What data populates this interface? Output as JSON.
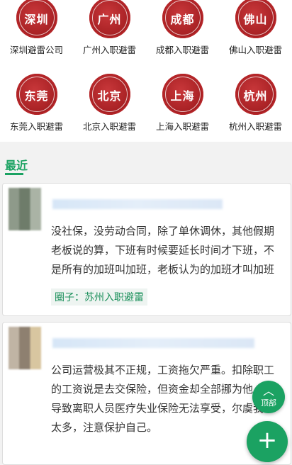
{
  "circles": [
    {
      "seal": "深圳",
      "label": "深圳避雷公司"
    },
    {
      "seal": "广州",
      "label": "广州入职避雷"
    },
    {
      "seal": "成都",
      "label": "成都入职避雷"
    },
    {
      "seal": "佛山",
      "label": "佛山入职避雷"
    },
    {
      "seal": "东莞",
      "label": "东莞入职避雷"
    },
    {
      "seal": "北京",
      "label": "北京入职避雷"
    },
    {
      "seal": "上海",
      "label": "上海入职避雷"
    },
    {
      "seal": "杭州",
      "label": "杭州入职避雷"
    }
  ],
  "section": {
    "title": "最近"
  },
  "posts": [
    {
      "lines": [
        "没社保，没劳动合同，除了单休调休，其他假期",
        "老板说的算，下班有时候要延长时间才下班，不",
        "是所有的加班叫加班，老板认为的加班才叫加班"
      ],
      "tag": "圈子：苏州入职避雷"
    },
    {
      "lines": [
        "公司运营极其不正规，工资拖欠严重。扣除职工",
        "的工资说是去交保险，但资金却全部挪为他",
        "导致离职人员医疗失业保险无法享受，尔虞我诈",
        "太多，注意保护自己。"
      ]
    }
  ],
  "fab": {
    "top_label": "顶部",
    "top_icon": "︿",
    "add_icon": "+"
  },
  "colors": {
    "accent": "#1ba262",
    "seal": "#a51f22"
  }
}
